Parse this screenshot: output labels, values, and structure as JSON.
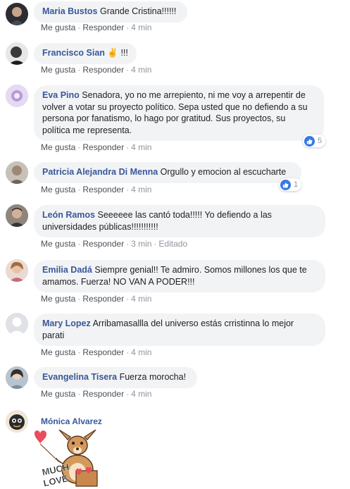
{
  "comments": [
    {
      "author": "Maria Bustos",
      "text": "Grande Cristina!!!!!!",
      "actions": {
        "like": "Me gusta",
        "reply": "Responder",
        "time": "4 min"
      }
    },
    {
      "author": "Francisco Sian",
      "text": "✌️ !!!",
      "actions": {
        "like": "Me gusta",
        "reply": "Responder",
        "time": "4 min"
      }
    },
    {
      "author": "Eva Pino",
      "text": "Senadora, yo no me arrepiento, ni me voy a arrepentir de volver a votar su proyecto político. Sepa usted que no defiendo a su persona por fanatismo, lo hago por gratitud. Sus proyectos, su política me representa.",
      "actions": {
        "like": "Me gusta",
        "reply": "Responder",
        "time": "4 min"
      },
      "reactions": {
        "icon": "like-icon",
        "count": "5"
      }
    },
    {
      "author": "Patricia Alejandra Di Menna",
      "text": "Orgullo y emocion al escucharte",
      "actions": {
        "like": "Me gusta",
        "reply": "Responder",
        "time": "4 min"
      },
      "reactions": {
        "icon": "like-icon",
        "count": "1"
      }
    },
    {
      "author": "León Ramos",
      "text": "Seeeeee las cantó toda!!!!! Yo defiendo a las universidades públicas!!!!!!!!!!!",
      "actions": {
        "like": "Me gusta",
        "reply": "Responder",
        "time": "3 min",
        "edited": "Editado"
      }
    },
    {
      "author": "Emilia Dadá",
      "text": "Siempre genial!! Te admiro. Somos millones los que te amamos. Fuerza! NO VAN A PODER!!!",
      "actions": {
        "like": "Me gusta",
        "reply": "Responder",
        "time": "4 min"
      }
    },
    {
      "author": "Mary Lopez",
      "text": "Arribamasallla del universo estás crristinna lo mejor parati",
      "actions": {
        "like": "Me gusta",
        "reply": "Responder",
        "time": "4 min"
      }
    },
    {
      "author": "Evangelina Tisera",
      "text": "Fuerza morocha!",
      "actions": {
        "like": "Me gusta",
        "reply": "Responder",
        "time": "4 min"
      }
    },
    {
      "author": "Mónica Alvarez",
      "sticker": "much-love-deer-sticker",
      "sticker_text": [
        "MUCH",
        "LOVE"
      ]
    }
  ],
  "dot": "·",
  "colors": {
    "author": "#385898",
    "bubble": "#f2f3f5",
    "like": "#3578e5",
    "meta": "#90949c"
  }
}
